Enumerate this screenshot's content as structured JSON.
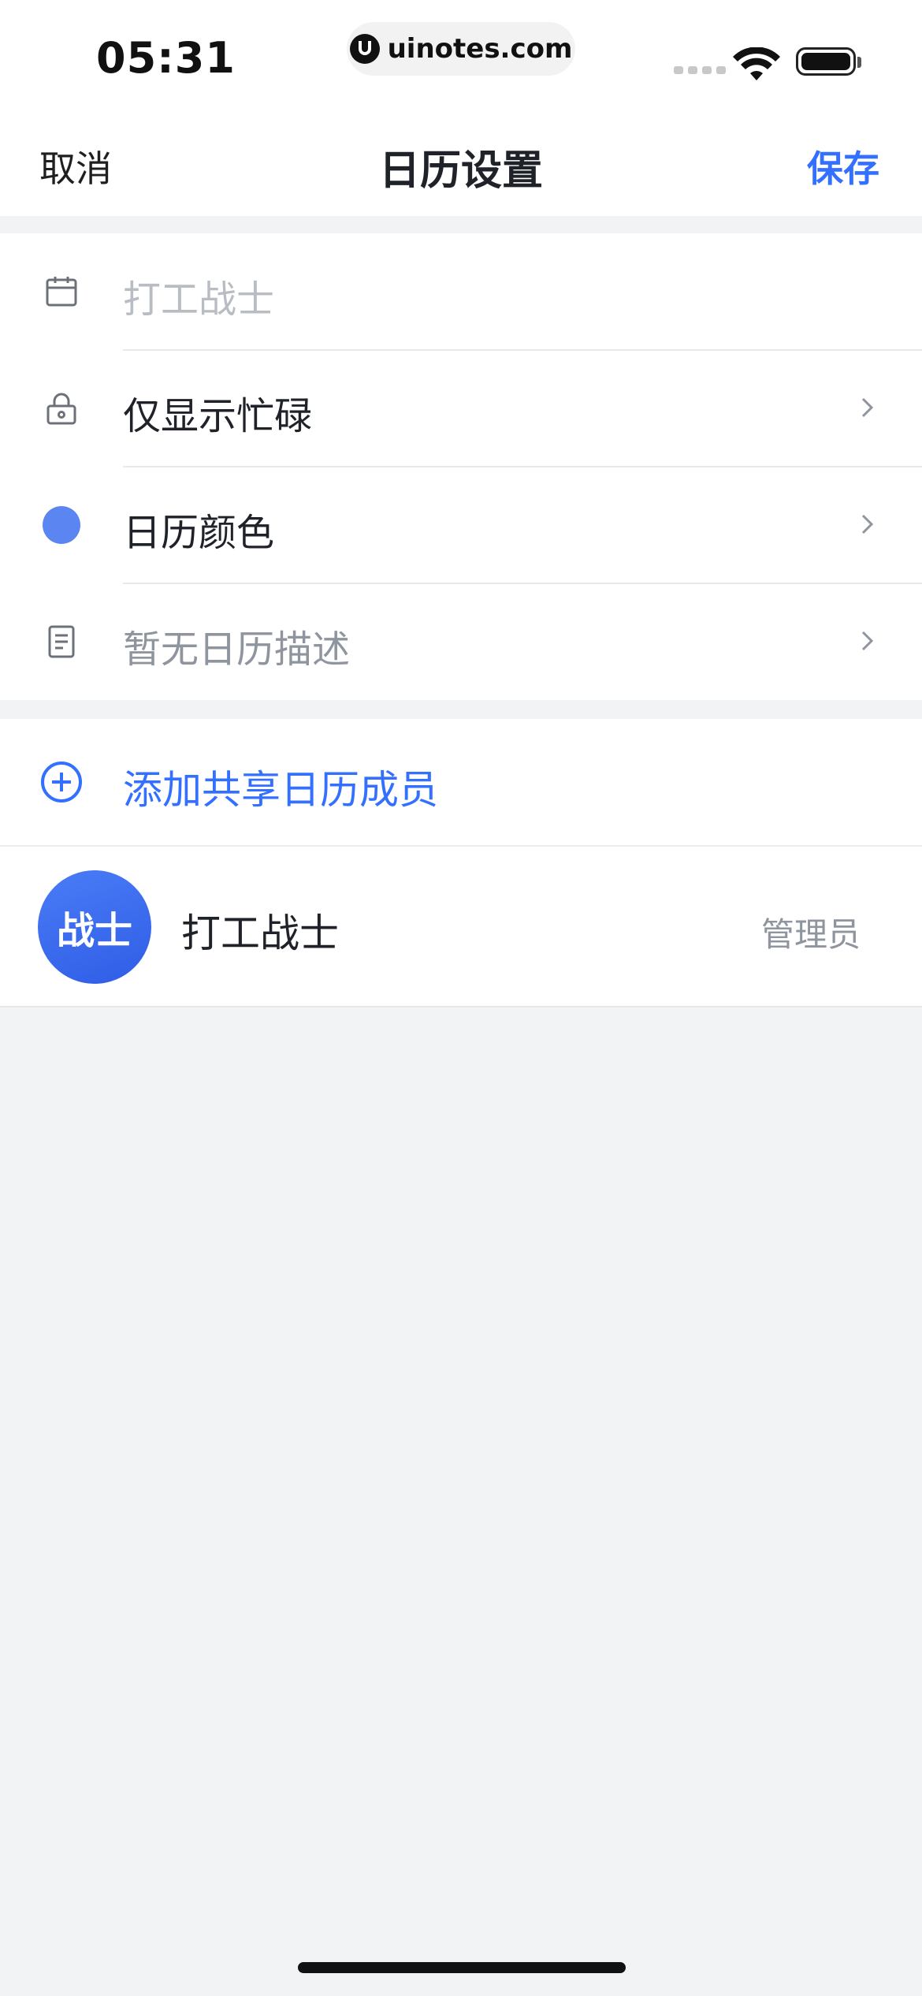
{
  "status_bar": {
    "time": "05:31",
    "url": "uinotes.com"
  },
  "nav": {
    "cancel_label": "取消",
    "title": "日历设置",
    "save_label": "保存"
  },
  "settings": {
    "name_placeholder": "打工战士",
    "visibility_label": "仅显示忙碌",
    "color_label": "日历颜色",
    "calendar_color": "#5b86f1",
    "description_label": "暂无日历描述"
  },
  "sharing": {
    "add_member_label": "添加共享日历成员",
    "members": [
      {
        "avatar_text": "战士",
        "name": "打工战士",
        "role": "管理员"
      }
    ]
  },
  "colors": {
    "accent": "#3370ff",
    "background": "#f2f3f5"
  }
}
